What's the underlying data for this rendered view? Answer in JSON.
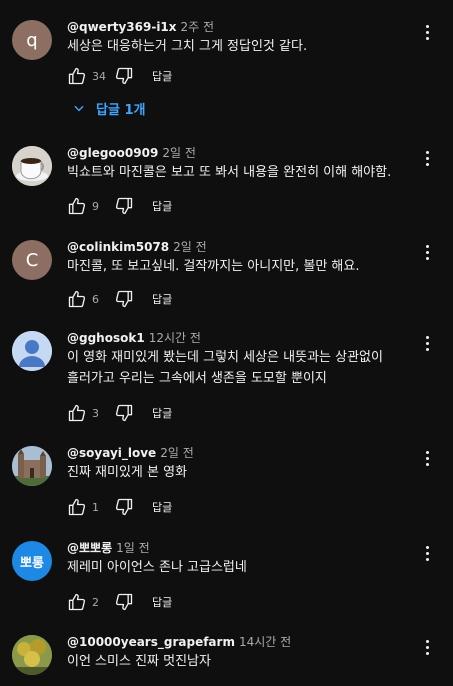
{
  "reply_label": "답글",
  "replies_toggle": "답글 1개",
  "comments": [
    {
      "author": "@qwerty369-i1x",
      "time": "2주 전",
      "lines": [
        "세상은 대응하는거 그치 그게 정답인것 같다."
      ],
      "likes": "34",
      "avatar_text": "q",
      "avatar_color": "#8d6e63"
    },
    {
      "author": "@glegoo0909",
      "time": "2일 전",
      "lines": [
        "빅쇼트와 마진콜은 보고 또 봐서 내용을 완전히 이해 해야함."
      ],
      "likes": "9",
      "avatar_text": "",
      "avatar_color": "#cfcfcf"
    },
    {
      "author": "@colinkim5078",
      "time": "2일 전",
      "lines": [
        "마진콜, 또 보고싶네. 걸작까지는 아니지만, 볼만 해요."
      ],
      "likes": "6",
      "avatar_text": "C",
      "avatar_color": "#8d6e63"
    },
    {
      "author": "@gghosok1",
      "time": "12시간 전",
      "lines": [
        "이 영화 재미있게 봤는데 그렇치 세상은 내뜻과는 상관없이",
        "흘러가고 우리는 그속에서 생존을 도모할 뿐이지"
      ],
      "likes": "3",
      "avatar_text": "",
      "avatar_color": "#c5d9f5"
    },
    {
      "author": "@soyayi_love",
      "time": "2일 전",
      "lines": [
        "진짜 재미있게  본 영화"
      ],
      "likes": "1",
      "avatar_text": "",
      "avatar_color": "#9fb0c4"
    },
    {
      "author": "@뽀뽀롱",
      "time": "1일 전",
      "lines": [
        "제레미 아이언스 존나 고급스럽네"
      ],
      "likes": "2",
      "avatar_text": "뽀롱",
      "avatar_color": "#1e88e5"
    },
    {
      "author": "@10000years_grapefarm",
      "time": "14시간 전",
      "lines": [
        "이언 스미스 진짜 멋진남자"
      ],
      "likes": "",
      "avatar_text": "",
      "avatar_color": "#6d7b3a"
    }
  ]
}
